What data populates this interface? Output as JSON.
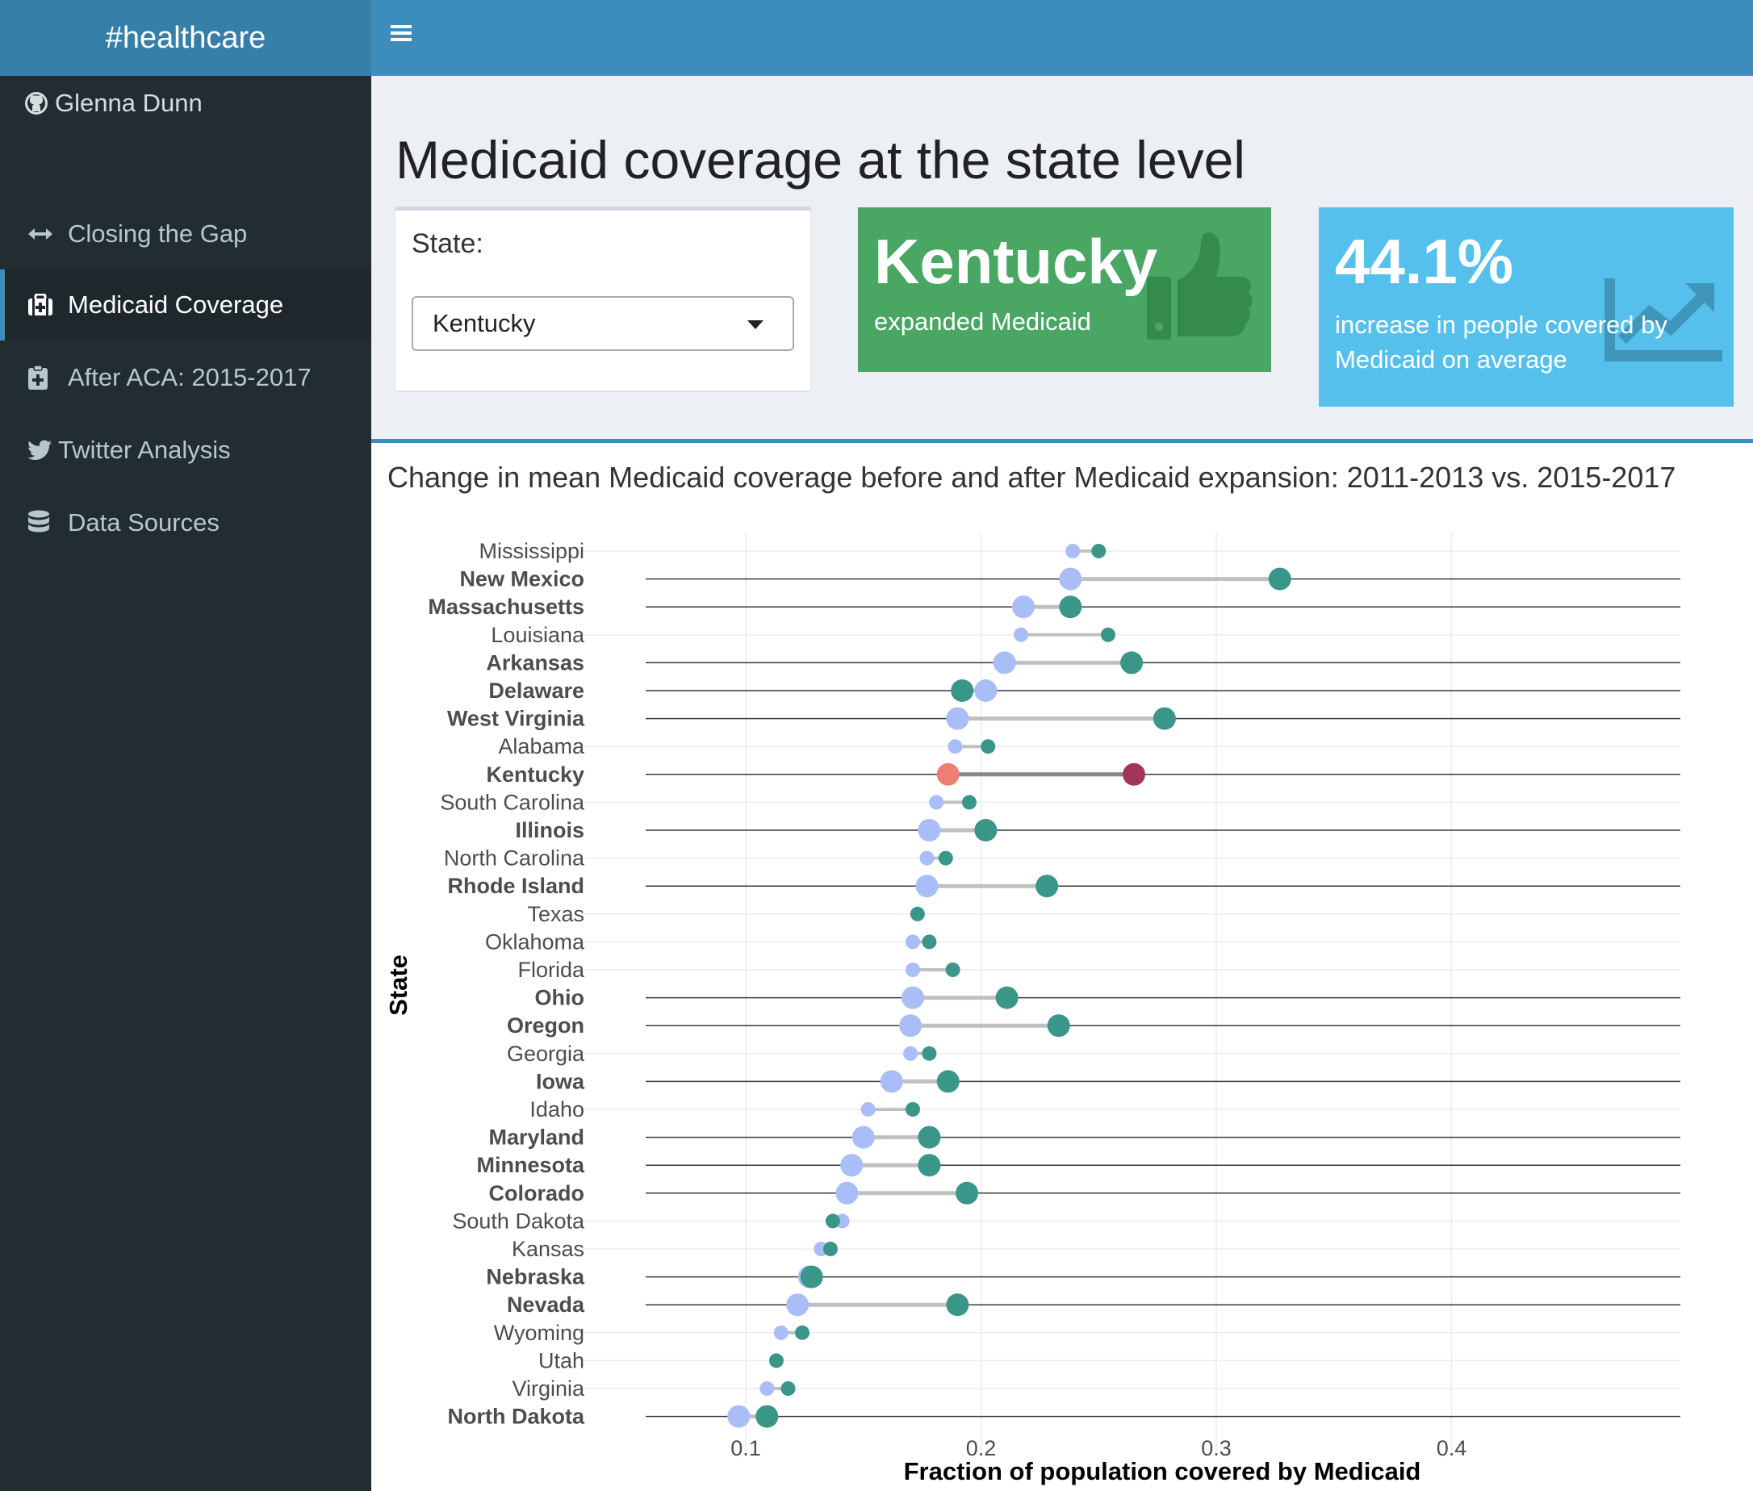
{
  "app": {
    "title": "#healthcare"
  },
  "sidebar": {
    "author": "Glenna Dunn",
    "items": [
      {
        "label": "Closing the Gap",
        "icon": "arrows-h-icon",
        "active": false
      },
      {
        "label": "Medicaid Coverage",
        "icon": "medkit-icon",
        "active": true
      },
      {
        "label": "After ACA: 2015-2017",
        "icon": "clipboard-plus-icon",
        "active": false
      },
      {
        "label": "Twitter Analysis",
        "icon": "twitter-icon",
        "active": false
      },
      {
        "label": "Data Sources",
        "icon": "database-icon",
        "active": false
      }
    ]
  },
  "header": {
    "menu_icon": "hamburger-icon"
  },
  "main": {
    "title": "Medicaid coverage at the state level",
    "state_input": {
      "label": "State:",
      "value": "Kentucky"
    },
    "status_box": {
      "value": "Kentucky",
      "subtitle": "expanded Medicaid",
      "icon": "thumbs-up-icon",
      "color": "#4aa663"
    },
    "increase_box": {
      "value": "44.1%",
      "subtitle": "increase in people covered by Medicaid on average",
      "icon": "line-chart-icon",
      "color": "#56c0ec"
    },
    "chart_box_title": "Change in mean Medicaid coverage before and after Medicaid expansion: 2011-2013 vs. 2015-2017"
  },
  "chart_data": {
    "type": "dumbbell",
    "xlabel": "Fraction of population covered by Medicaid",
    "ylabel": "State",
    "xlim": [
      0.03,
      0.5
    ],
    "xticks": [
      0.1,
      0.2,
      0.3,
      0.4
    ],
    "grid": true,
    "highlight": "Kentucky",
    "colors": {
      "before": "#a9bdf7",
      "after": "#3a9688",
      "highlight_before": "#ef7f72",
      "highlight_after": "#a1355c",
      "connector": "#c0c0c0",
      "highlight_connector": "#888880"
    },
    "series": [
      {
        "name": "2011-2013",
        "key": "before"
      },
      {
        "name": "2015-2017",
        "key": "after"
      }
    ],
    "states": [
      {
        "name": "Mississippi",
        "before": 0.239,
        "after": 0.25,
        "expanded": false
      },
      {
        "name": "New Mexico",
        "before": 0.238,
        "after": 0.327,
        "expanded": true
      },
      {
        "name": "Massachusetts",
        "before": 0.218,
        "after": 0.238,
        "expanded": true
      },
      {
        "name": "Louisiana",
        "before": 0.217,
        "after": 0.254,
        "expanded": false
      },
      {
        "name": "Arkansas",
        "before": 0.21,
        "after": 0.264,
        "expanded": true
      },
      {
        "name": "Delaware",
        "before": 0.202,
        "after": 0.192,
        "expanded": true
      },
      {
        "name": "West Virginia",
        "before": 0.19,
        "after": 0.278,
        "expanded": true
      },
      {
        "name": "Alabama",
        "before": 0.189,
        "after": 0.203,
        "expanded": false
      },
      {
        "name": "Kentucky",
        "before": 0.186,
        "after": 0.265,
        "expanded": true
      },
      {
        "name": "South Carolina",
        "before": 0.181,
        "after": 0.195,
        "expanded": false
      },
      {
        "name": "Illinois",
        "before": 0.178,
        "after": 0.202,
        "expanded": true
      },
      {
        "name": "North Carolina",
        "before": 0.177,
        "after": 0.185,
        "expanded": false
      },
      {
        "name": "Rhode Island",
        "before": 0.177,
        "after": 0.228,
        "expanded": true
      },
      {
        "name": "Texas",
        "before": 0.173,
        "after": 0.173,
        "expanded": false
      },
      {
        "name": "Oklahoma",
        "before": 0.171,
        "after": 0.178,
        "expanded": false
      },
      {
        "name": "Florida",
        "before": 0.171,
        "after": 0.188,
        "expanded": false
      },
      {
        "name": "Ohio",
        "before": 0.171,
        "after": 0.211,
        "expanded": true
      },
      {
        "name": "Oregon",
        "before": 0.17,
        "after": 0.233,
        "expanded": true
      },
      {
        "name": "Georgia",
        "before": 0.17,
        "after": 0.178,
        "expanded": false
      },
      {
        "name": "Iowa",
        "before": 0.162,
        "after": 0.186,
        "expanded": true
      },
      {
        "name": "Idaho",
        "before": 0.152,
        "after": 0.171,
        "expanded": false
      },
      {
        "name": "Maryland",
        "before": 0.15,
        "after": 0.178,
        "expanded": true
      },
      {
        "name": "Minnesota",
        "before": 0.145,
        "after": 0.178,
        "expanded": true
      },
      {
        "name": "Colorado",
        "before": 0.143,
        "after": 0.194,
        "expanded": true
      },
      {
        "name": "South Dakota",
        "before": 0.141,
        "after": 0.137,
        "expanded": false
      },
      {
        "name": "Kansas",
        "before": 0.132,
        "after": 0.136,
        "expanded": false
      },
      {
        "name": "Nebraska",
        "before": 0.127,
        "after": 0.128,
        "expanded": true
      },
      {
        "name": "Nevada",
        "before": 0.122,
        "after": 0.19,
        "expanded": true
      },
      {
        "name": "Wyoming",
        "before": 0.115,
        "after": 0.124,
        "expanded": false
      },
      {
        "name": "Utah",
        "before": 0.113,
        "after": 0.113,
        "expanded": false
      },
      {
        "name": "Virginia",
        "before": 0.109,
        "after": 0.118,
        "expanded": false
      },
      {
        "name": "North Dakota",
        "before": 0.097,
        "after": 0.109,
        "expanded": true
      }
    ]
  }
}
